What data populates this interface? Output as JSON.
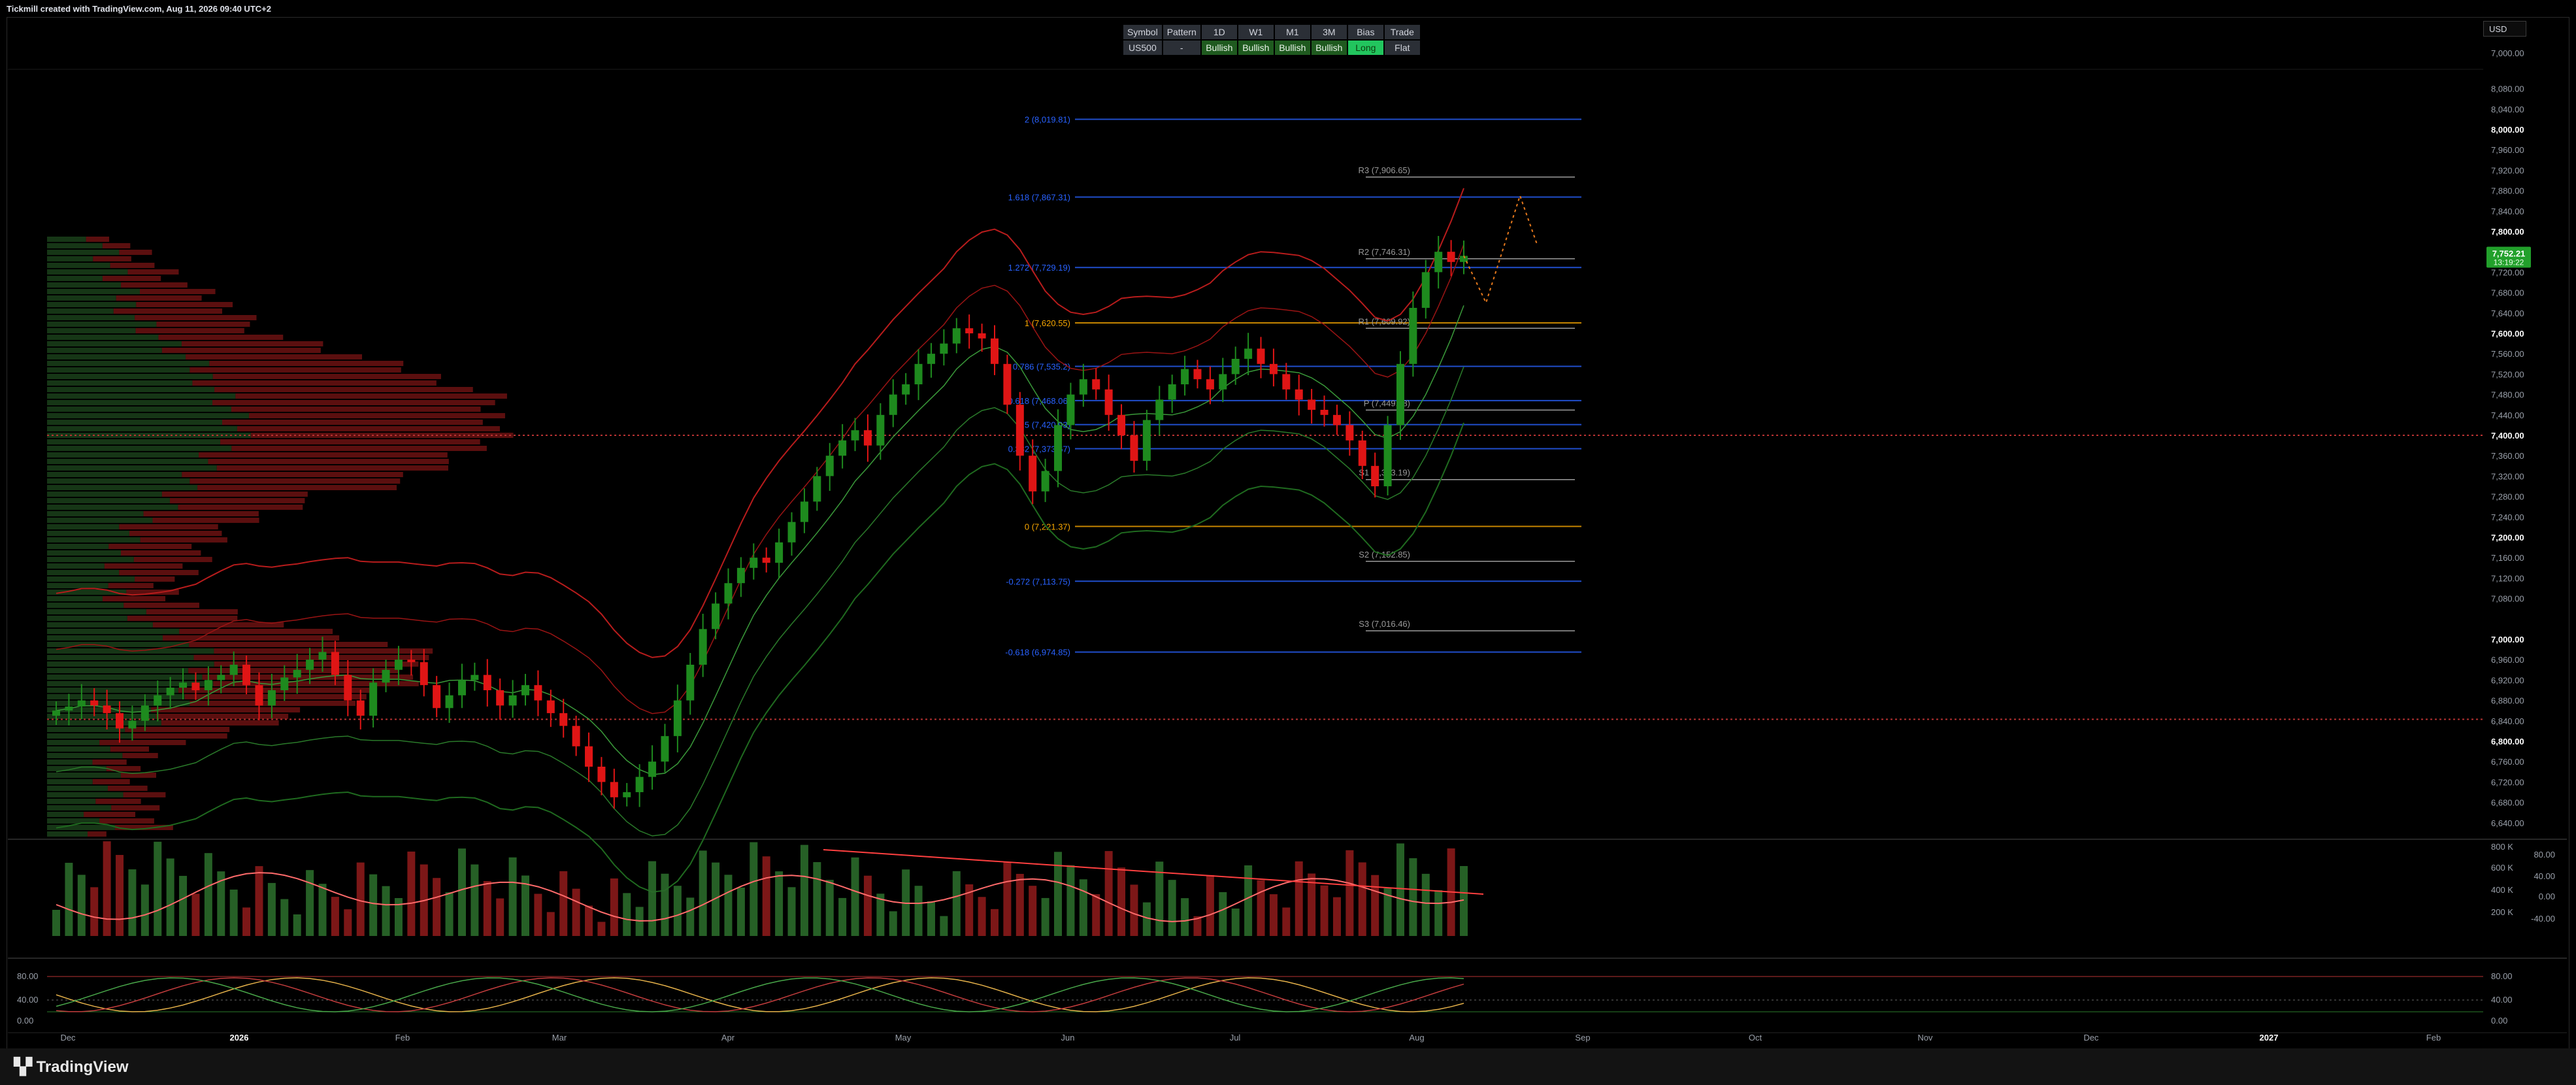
{
  "header": {
    "caption": "Tickmill created with TradingView.com, Aug 11, 2026 09:40 UTC+2"
  },
  "footer": {
    "logo_text": "TradingView"
  },
  "currency": "USD",
  "bias_table": {
    "headers": [
      "Symbol",
      "Pattern",
      "1D",
      "W1",
      "M1",
      "3M",
      "Bias",
      "Trade"
    ],
    "row": [
      "US500",
      "-",
      "Bullish",
      "Bullish",
      "Bullish",
      "Bullish",
      "Long",
      "Flat"
    ]
  },
  "colors": {
    "up": "#1e8a1e",
    "down": "#e01515",
    "fib": "#2962ff",
    "fib_key": "#f7a600",
    "pivot": "#9b9b9b",
    "price_tag": "#22a02b"
  },
  "chart_data": {
    "type": "candlestick",
    "price_axis_labels": [
      "7,000.00",
      "8,080.00",
      "8,040.00",
      "8,000.00",
      "7,960.00",
      "7,920.00",
      "7,880.00",
      "7,840.00",
      "7,800.00",
      "7,760.00",
      "7,720.00",
      "7,680.00",
      "7,640.00",
      "7,600.00",
      "7,560.00",
      "7,520.00",
      "7,480.00",
      "7,440.00",
      "7,400.00",
      "7,360.00",
      "7,320.00",
      "7,280.00",
      "7,240.00",
      "7,200.00",
      "7,160.00",
      "7,120.00",
      "7,080.00",
      "7,000.00",
      "6,960.00",
      "6,920.00",
      "6,880.00",
      "6,840.00",
      "6,800.00",
      "6,760.00",
      "6,720.00",
      "6,680.00",
      "6,640.00"
    ],
    "bold_price_labels": [
      "8,000.00",
      "7,800.00",
      "7,600.00",
      "7,400.00",
      "7,200.00",
      "7,000.00",
      "6,800.00"
    ],
    "current_price": "7,752.21",
    "countdown": "13:19:22",
    "x_axis_labels": [
      "Dec",
      "2026",
      "Feb",
      "Mar",
      "Apr",
      "May",
      "Jun",
      "Jul",
      "Aug",
      "Sep",
      "Oct",
      "Nov",
      "Dec",
      "2027",
      "Feb"
    ],
    "fib_levels": [
      {
        "label": "2 (8,019.81)",
        "value": 8019.81
      },
      {
        "label": "1.618 (7,867.31)",
        "value": 7867.31
      },
      {
        "label": "1.272 (7,729.19)",
        "value": 7729.19
      },
      {
        "label": "1 (7,620.55)",
        "value": 7620.55
      },
      {
        "label": "0.786 (7,535.2)",
        "value": 7535.2
      },
      {
        "label": "0.618 (7,468.06)",
        "value": 7468.06
      },
      {
        "label": "0.5 (7,420.93)",
        "value": 7420.93
      },
      {
        "label": "0.382 (7,373.67)",
        "value": 7373.67
      },
      {
        "label": "0 (7,221.37)",
        "value": 7221.37
      },
      {
        "label": "-0.272 (7,113.75)",
        "value": 7113.75
      },
      {
        "label": "-0.618 (6,974.85)",
        "value": 6974.85
      }
    ],
    "pivots": [
      {
        "label": "R3 (7,906.65)",
        "value": 7906.65
      },
      {
        "label": "R2 (7,746.31)",
        "value": 7746.31
      },
      {
        "label": "R1 (7,609.92)",
        "value": 7609.92
      },
      {
        "label": "P (7,449.58)",
        "value": 7449.58
      },
      {
        "label": "S1 (7,313.19)",
        "value": 7313.19
      },
      {
        "label": "S2 (7,152.85)",
        "value": 7152.85
      },
      {
        "label": "S3 (7,016.46)",
        "value": 7016.46
      }
    ],
    "horizontal_levels": [
      7400,
      6843
    ],
    "volume_axis_labels": [
      "800 K",
      "600 K",
      "400 K",
      "200 K"
    ],
    "volume_osc_labels": [
      "80.00",
      "40.00",
      "0.00",
      "-40.00"
    ],
    "stoch_labels": [
      "80.00",
      "40.00",
      "0.00"
    ],
    "stoch_right_labels": [
      "80.00",
      "40.00",
      "0.00"
    ],
    "close_path": [
      6860,
      6868,
      6880,
      6870,
      6855,
      6825,
      6840,
      6870,
      6890,
      6905,
      6915,
      6900,
      6920,
      6930,
      6950,
      6910,
      6870,
      6900,
      6925,
      6940,
      6960,
      6975,
      6930,
      6880,
      6850,
      6915,
      6940,
      6960,
      6955,
      6910,
      6865,
      6890,
      6920,
      6930,
      6900,
      6870,
      6890,
      6910,
      6880,
      6855,
      6830,
      6790,
      6750,
      6720,
      6690,
      6700,
      6730,
      6760,
      6810,
      6880,
      6950,
      7020,
      7070,
      7110,
      7140,
      7160,
      7150,
      7190,
      7230,
      7270,
      7320,
      7360,
      7390,
      7410,
      7380,
      7440,
      7480,
      7500,
      7540,
      7560,
      7580,
      7610,
      7600,
      7590,
      7540,
      7460,
      7360,
      7290,
      7330,
      7420,
      7480,
      7510,
      7490,
      7440,
      7400,
      7350,
      7430,
      7470,
      7500,
      7530,
      7510,
      7490,
      7520,
      7550,
      7570,
      7540,
      7520,
      7490,
      7470,
      7450,
      7440,
      7420,
      7390,
      7340,
      7300,
      7420,
      7540,
      7650,
      7720,
      7760,
      7740,
      7752
    ]
  }
}
